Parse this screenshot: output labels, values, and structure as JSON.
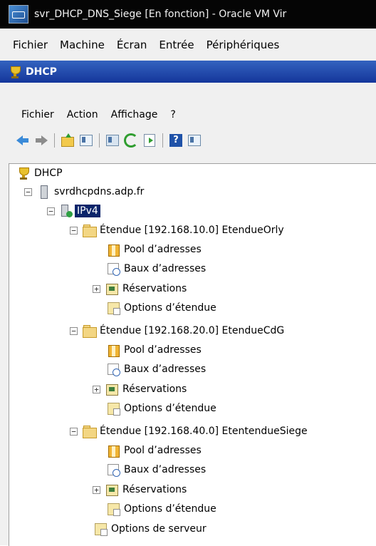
{
  "vbox": {
    "title": "svr_DHCP_DNS_Siege [En fonction] - Oracle VM Vir",
    "menu": [
      "Fichier",
      "Machine",
      "Écran",
      "Entrée",
      "Périphériques"
    ]
  },
  "mmc": {
    "title": "DHCP",
    "menu": [
      "Fichier",
      "Action",
      "Affichage",
      "?"
    ],
    "toolbar_icons": [
      "back-arrow-icon",
      "forward-arrow-icon",
      "up-folder-icon",
      "show-hide-console-tree-icon",
      "properties-icon",
      "refresh-icon",
      "export-list-icon",
      "help-icon",
      "show-hide-action-pane-icon"
    ]
  },
  "tree": {
    "root": "DHCP",
    "server": "svrdhcpdns.adp.fr",
    "ipv4": "IPv4",
    "scopes": [
      {
        "label": "Étendue [192.168.10.0] EtendueOrly"
      },
      {
        "label": "Étendue [192.168.20.0] EtendueCdG"
      },
      {
        "label": "Étendue [192.168.40.0] EtentendueSiege"
      }
    ],
    "children": {
      "pool": "Pool d’adresses",
      "leases": "Baux d’adresses",
      "reservations": "Réservations",
      "scope_options": "Options d’étendue"
    },
    "server_options": "Options de serveur"
  }
}
